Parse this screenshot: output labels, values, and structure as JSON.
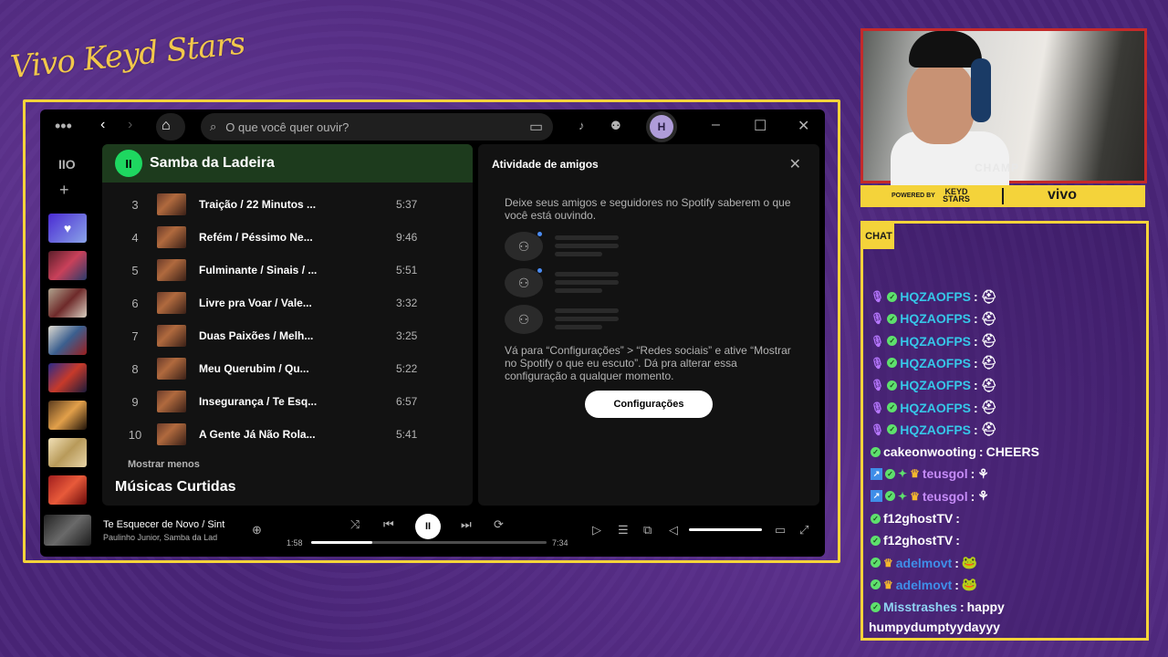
{
  "overlay": {
    "logo_text": "Vivo Keyd Stars",
    "cam_badge": "CHAMP",
    "sponsor_powered": "POWERED BY",
    "sponsor_keyd": "KEYD STARS",
    "sponsor_vivo": "vivo",
    "chat_tag": "CHAT"
  },
  "spotify": {
    "search_placeholder": "O que você quer ouvir?",
    "avatar_initial": "H",
    "now_playing_header": "Samba da Ladeira",
    "tracks": [
      {
        "num": "3",
        "name": "Traição / 22 Minutos ...",
        "dur": "5:37"
      },
      {
        "num": "4",
        "name": "Refém / Péssimo Ne...",
        "dur": "9:46"
      },
      {
        "num": "5",
        "name": "Fulminante / Sinais / ...",
        "dur": "5:51"
      },
      {
        "num": "6",
        "name": "Livre pra Voar / Vale...",
        "dur": "3:32"
      },
      {
        "num": "7",
        "name": "Duas Paixões / Melh...",
        "dur": "3:25"
      },
      {
        "num": "8",
        "name": "Meu Querubim / Qu...",
        "dur": "5:22"
      },
      {
        "num": "9",
        "name": "Insegurança / Te Esq...",
        "dur": "6:57"
      },
      {
        "num": "10",
        "name": "A Gente Já Não Rola...",
        "dur": "5:41"
      }
    ],
    "show_less": "Mostrar menos",
    "liked_songs": "Músicas Curtidas",
    "friends": {
      "title": "Atividade de amigos",
      "intro": "Deixe seus amigos e seguidores no Spotify saberem o que você está ouvindo.",
      "instructions": "Vá para “Configurações” > “Redes sociais” e ative “Mostrar no Spotify o que eu escuto”. Dá pra alterar essa configuração a qualquer momento.",
      "button": "Configurações"
    },
    "player": {
      "title": "Te Esquecer de Novo / Sint",
      "artist": "Paulinho Junior, Samba da Lad",
      "elapsed": "1:58",
      "total": "7:34",
      "progress": 0.26,
      "volume": 1.0
    }
  },
  "chat": {
    "messages": [
      {
        "user": "HQZAOFPS",
        "color": "#36c7e8",
        "badges": [
          "mic",
          "ok"
        ],
        "text": ""
      },
      {
        "user": "HQZAOFPS",
        "color": "#36c7e8",
        "badges": [
          "mic",
          "ok"
        ],
        "text": ""
      },
      {
        "user": "HQZAOFPS",
        "color": "#36c7e8",
        "badges": [
          "mic",
          "ok"
        ],
        "text": ""
      },
      {
        "user": "HQZAOFPS",
        "color": "#36c7e8",
        "badges": [
          "mic",
          "ok"
        ],
        "text": ""
      },
      {
        "user": "HQZAOFPS",
        "color": "#36c7e8",
        "badges": [
          "mic",
          "ok"
        ],
        "text": ""
      },
      {
        "user": "HQZAOFPS",
        "color": "#36c7e8",
        "badges": [
          "mic",
          "ok"
        ],
        "text": ""
      },
      {
        "user": "HQZAOFPS",
        "color": "#36c7e8",
        "badges": [
          "mic",
          "ok"
        ],
        "text": ""
      },
      {
        "user": "cakeonwooting",
        "color": "#ffffff",
        "badges": [
          "ok"
        ],
        "text": "CHEERS"
      },
      {
        "user": "teusgol",
        "color": "#c58bf7",
        "badges": [
          "sub",
          "ok",
          "gem",
          "crown"
        ],
        "text": ""
      },
      {
        "user": "teusgol",
        "color": "#c58bf7",
        "badges": [
          "sub",
          "ok",
          "gem",
          "crown"
        ],
        "text": ""
      },
      {
        "user": "f12ghostTV",
        "color": "#ffffff",
        "badges": [
          "ok"
        ],
        "text": ""
      },
      {
        "user": "f12ghostTV",
        "color": "#ffffff",
        "badges": [
          "ok"
        ],
        "text": ""
      },
      {
        "user": "adelmovt",
        "color": "#3f8ee8",
        "badges": [
          "ok",
          "crown"
        ],
        "text": ""
      },
      {
        "user": "adelmovt",
        "color": "#3f8ee8",
        "badges": [
          "ok",
          "crown"
        ],
        "text": ""
      },
      {
        "user": "Misstrashes",
        "color": "#8fd4f2",
        "badges": [
          "ok"
        ],
        "text": "happy"
      }
    ],
    "wrap_line": "humpydumptyydayyy"
  }
}
